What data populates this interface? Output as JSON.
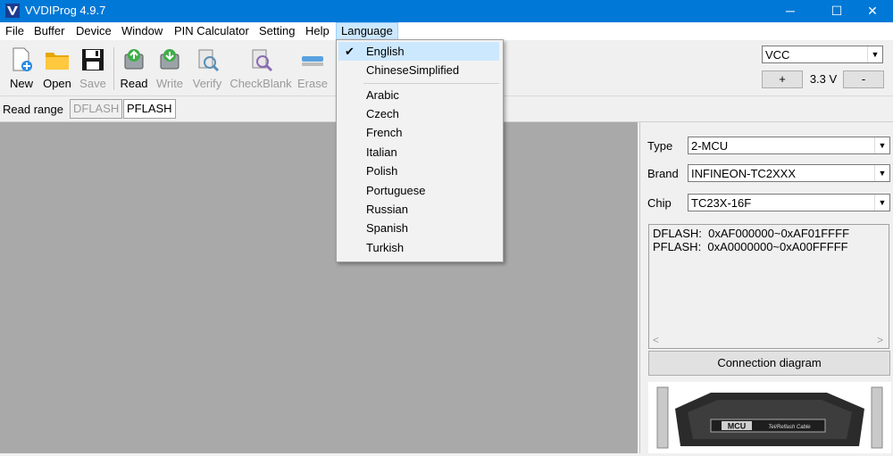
{
  "window": {
    "title": "VVDIProg 4.9.7",
    "minimize": "─",
    "maximize": "☐",
    "close": "✕"
  },
  "menubar": [
    "File",
    "Buffer",
    "Device",
    "Window",
    "PIN Calculator",
    "Setting",
    "Help",
    "Language"
  ],
  "toolbar": {
    "new": "New",
    "open": "Open",
    "save": "Save",
    "read": "Read",
    "write": "Write",
    "verify": "Verify",
    "checkblank": "CheckBlank",
    "erase": "Erase"
  },
  "vcc": {
    "selected": "VCC",
    "plus": "+",
    "voltage": "3.3 V",
    "minus": "-"
  },
  "read_range": {
    "label": "Read range",
    "tabs": [
      "DFLASH",
      "PFLASH"
    ]
  },
  "panel": {
    "type_label": "Type",
    "type_value": "2-MCU",
    "brand_label": "Brand",
    "brand_value": "INFINEON-TC2XXX",
    "chip_label": "Chip",
    "chip_value": "TC23X-16F",
    "info_lines": [
      "DFLASH:  0xAF000000~0xAF01FFFF",
      "PFLASH:  0xA0000000~0xA00FFFFF"
    ],
    "scroll_left": "<",
    "scroll_right": ">",
    "connection_button": "Connection diagram",
    "diagram_label": "MCU",
    "diagram_brand": "Tel/Reflash Cable"
  },
  "language_menu": {
    "checked_mark": "✔",
    "top": [
      "English",
      "ChineseSimplified"
    ],
    "others": [
      "Arabic",
      "Czech",
      "French",
      "Italian",
      "Polish",
      "Portuguese",
      "Russian",
      "Spanish",
      "Turkish"
    ]
  },
  "colors": {
    "titlebar": "#0078d7",
    "workspace": "#a9a9a9",
    "menu_highlight": "#cce8ff"
  }
}
